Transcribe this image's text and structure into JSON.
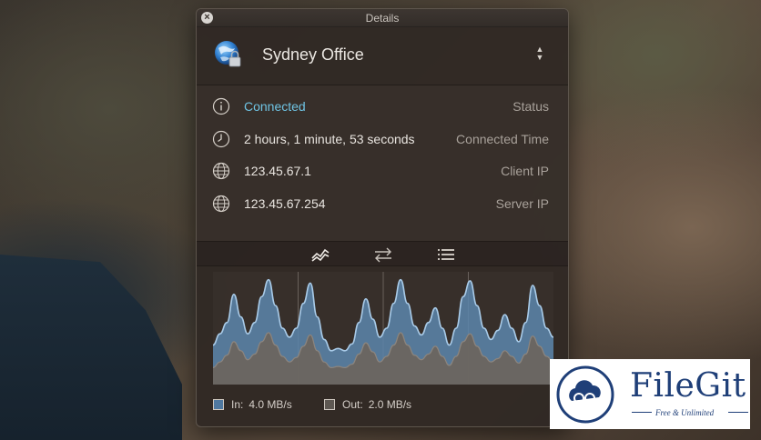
{
  "window": {
    "title": "Details"
  },
  "connection": {
    "name": "Sydney Office"
  },
  "details": [
    {
      "icon": "info-icon",
      "value": "Connected",
      "label": "Status"
    },
    {
      "icon": "clock-icon",
      "value": "2 hours, 1 minute, 53 seconds",
      "label": "Connected Time"
    },
    {
      "icon": "globe-icon",
      "value": "123.45.67.1",
      "label": "Client IP"
    },
    {
      "icon": "globe-icon",
      "value": "123.45.67.254",
      "label": "Server IP"
    }
  ],
  "tabs": [
    {
      "icon": "chart-icon",
      "selected": true
    },
    {
      "icon": "transfer-arrows-icon",
      "selected": false
    },
    {
      "icon": "list-icon",
      "selected": false
    }
  ],
  "legend": {
    "in": {
      "key": "In:",
      "value": "4.0 MB/s",
      "color": "#4f78a0"
    },
    "out": {
      "key": "Out:",
      "value": "2.0 MB/s",
      "color": "#5e5852"
    }
  },
  "colors": {
    "connected": "#6fc4e4",
    "in_fill": "#5c86ad",
    "out_fill": "#6b655f"
  },
  "chart_data": {
    "type": "area",
    "series": [
      {
        "name": "In",
        "values": [
          0.35,
          0.45,
          0.55,
          0.8,
          0.6,
          0.45,
          0.55,
          0.78,
          0.93,
          0.7,
          0.5,
          0.42,
          0.5,
          0.72,
          0.9,
          0.6,
          0.4,
          0.3,
          0.32,
          0.3,
          0.36,
          0.55,
          0.76,
          0.58,
          0.42,
          0.5,
          0.72,
          0.93,
          0.72,
          0.52,
          0.44,
          0.55,
          0.68,
          0.5,
          0.35,
          0.5,
          0.78,
          0.92,
          0.7,
          0.5,
          0.4,
          0.48,
          0.62,
          0.5,
          0.38,
          0.55,
          0.88,
          0.7,
          0.5,
          0.42
        ]
      },
      {
        "name": "Out",
        "values": [
          0.15,
          0.2,
          0.26,
          0.38,
          0.3,
          0.22,
          0.27,
          0.38,
          0.46,
          0.35,
          0.25,
          0.2,
          0.24,
          0.34,
          0.44,
          0.3,
          0.2,
          0.15,
          0.16,
          0.15,
          0.18,
          0.27,
          0.37,
          0.29,
          0.2,
          0.25,
          0.35,
          0.46,
          0.35,
          0.26,
          0.22,
          0.27,
          0.34,
          0.25,
          0.17,
          0.25,
          0.38,
          0.45,
          0.34,
          0.25,
          0.2,
          0.23,
          0.3,
          0.25,
          0.19,
          0.27,
          0.43,
          0.34,
          0.25,
          0.2
        ]
      }
    ]
  },
  "watermark": {
    "name": "FileGit",
    "tagline": "Free & Unlimited"
  }
}
